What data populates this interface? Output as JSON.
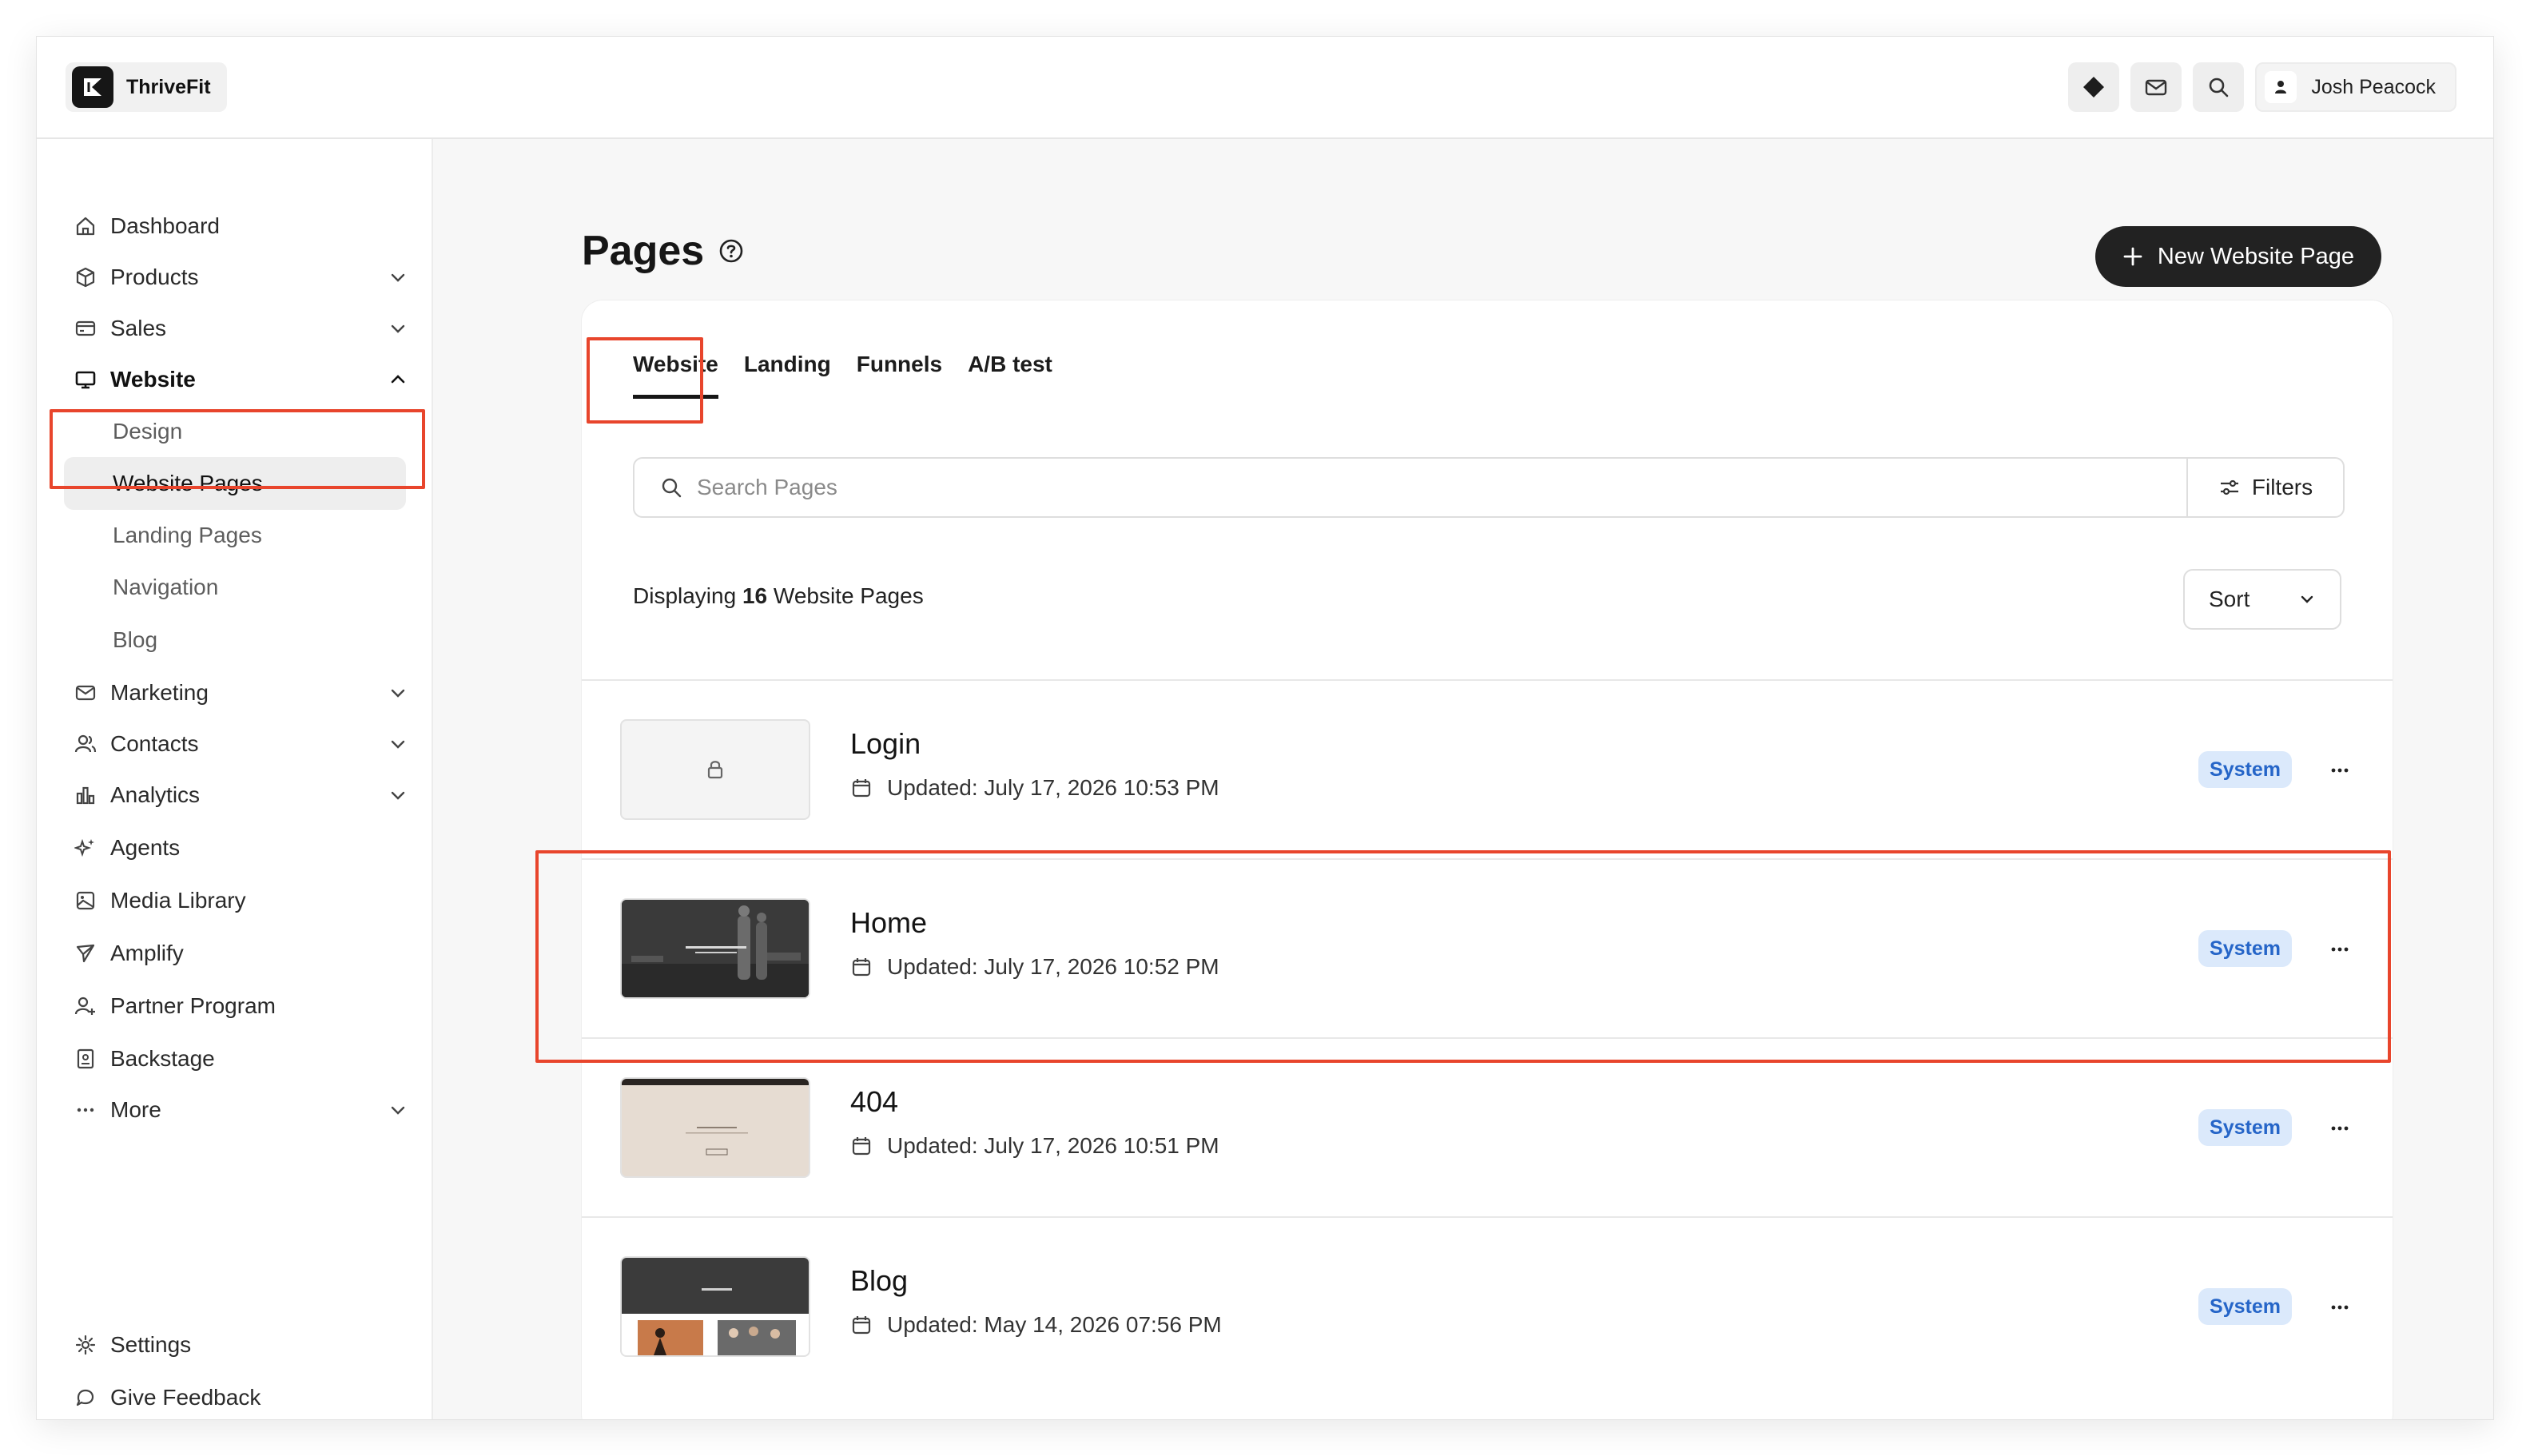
{
  "app": {
    "name": "ThriveFit"
  },
  "header": {
    "user_name": "Josh Peacock"
  },
  "sidebar": {
    "items": [
      {
        "label": "Dashboard"
      },
      {
        "label": "Products"
      },
      {
        "label": "Sales"
      },
      {
        "label": "Website"
      },
      {
        "label": "Marketing"
      },
      {
        "label": "Contacts"
      },
      {
        "label": "Analytics"
      },
      {
        "label": "Agents"
      },
      {
        "label": "Media Library"
      },
      {
        "label": "Amplify"
      },
      {
        "label": "Partner Program"
      },
      {
        "label": "Backstage"
      },
      {
        "label": "More"
      }
    ],
    "website_sub": [
      {
        "label": "Design"
      },
      {
        "label": "Website Pages"
      },
      {
        "label": "Landing Pages"
      },
      {
        "label": "Navigation"
      },
      {
        "label": "Blog"
      }
    ],
    "footer": [
      {
        "label": "Settings"
      },
      {
        "label": "Give Feedback"
      }
    ]
  },
  "main": {
    "title": "Pages",
    "new_button": "New Website Page",
    "tabs": [
      {
        "label": "Website"
      },
      {
        "label": "Landing"
      },
      {
        "label": "Funnels"
      },
      {
        "label": "A/B test"
      }
    ],
    "search": {
      "placeholder": "Search Pages"
    },
    "filters_label": "Filters",
    "count": {
      "prefix": "Displaying",
      "number": "16",
      "suffix": "Website Pages"
    },
    "sort_label": "Sort",
    "pages": [
      {
        "title": "Login",
        "updated": "Updated: July 17, 2026 10:53 PM",
        "badge": "System"
      },
      {
        "title": "Home",
        "updated": "Updated: July 17, 2026 10:52 PM",
        "badge": "System"
      },
      {
        "title": "404",
        "updated": "Updated: July 17, 2026 10:51 PM",
        "badge": "System"
      },
      {
        "title": "Blog",
        "updated": "Updated: May 14, 2026 07:56 PM",
        "badge": "System"
      }
    ]
  },
  "colors": {
    "highlight": "#e8452c",
    "badge_bg": "#dbe9fb",
    "badge_text": "#2565c8",
    "primary_button": "#222222"
  }
}
